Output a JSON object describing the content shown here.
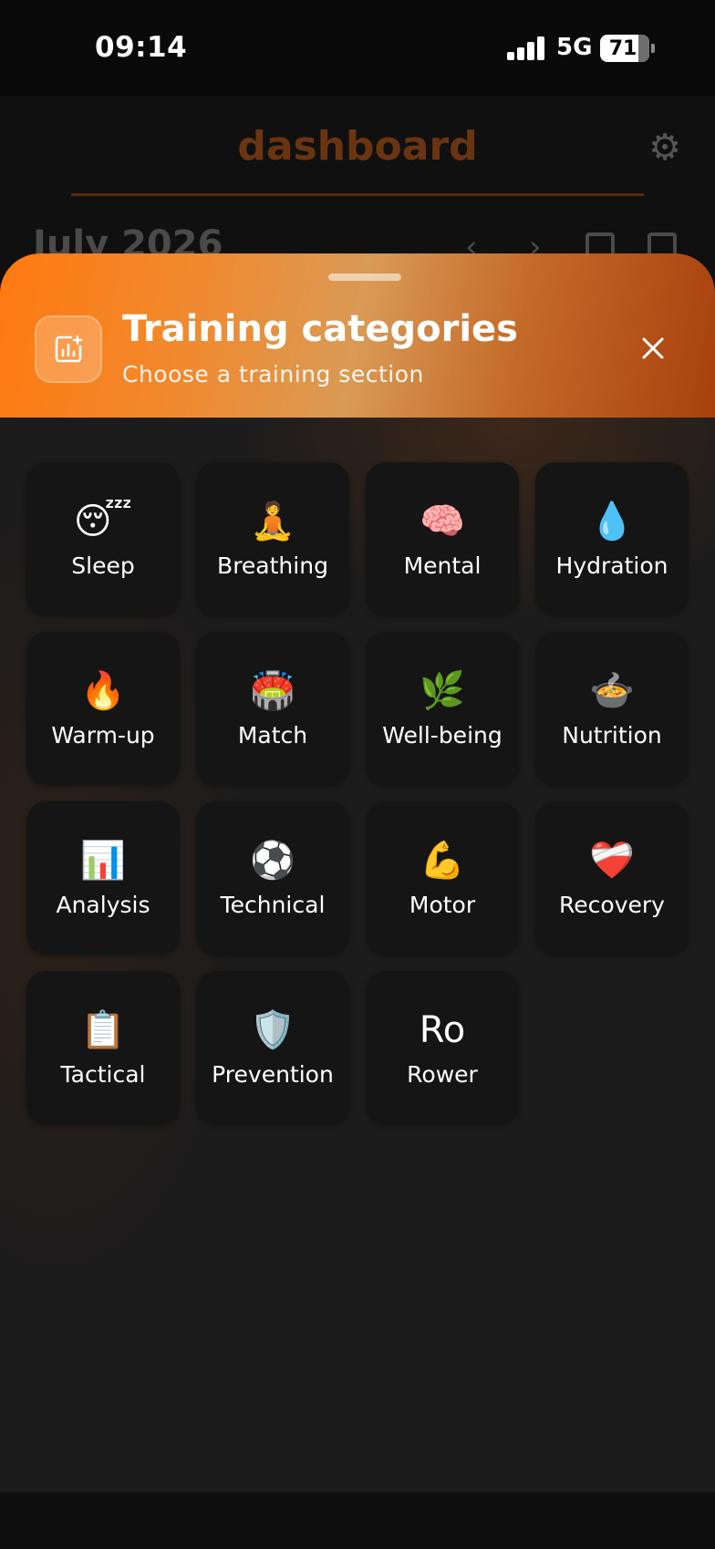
{
  "status_bar": {
    "time": "09:14",
    "network": "5G",
    "battery": "71"
  },
  "background": {
    "title": "dashboard",
    "month": "July 2026",
    "prev_icon": "chevron-left-icon",
    "next_icon": "chevron-right-icon"
  },
  "sheet": {
    "title": "Training categories",
    "subtitle": "Choose a training section",
    "header_icon": "chart-add-icon",
    "close_icon": "close-icon"
  },
  "categories": [
    {
      "label": "Sleep",
      "icon": "😴"
    },
    {
      "label": "Breathing",
      "icon": "🧘"
    },
    {
      "label": "Mental",
      "icon": "🧠"
    },
    {
      "label": "Hydration",
      "icon": "💧"
    },
    {
      "label": "Warm-up",
      "icon": "🔥"
    },
    {
      "label": "Match",
      "icon": "🏟️"
    },
    {
      "label": "Well-being",
      "icon": "🌿"
    },
    {
      "label": "Nutrition",
      "icon": "🍲"
    },
    {
      "label": "Analysis",
      "icon": "📊"
    },
    {
      "label": "Technical",
      "icon": "⚽"
    },
    {
      "label": "Motor",
      "icon": "💪"
    },
    {
      "label": "Recovery",
      "icon": "❤️‍🩹"
    },
    {
      "label": "Tactical",
      "icon": "📋"
    },
    {
      "label": "Prevention",
      "icon": "🛡️"
    },
    {
      "label": "Rower",
      "icon": "Ro"
    }
  ],
  "colors": {
    "accent": "#ff7a10",
    "tile": "#151515",
    "sheet": "#1d1c1c"
  }
}
